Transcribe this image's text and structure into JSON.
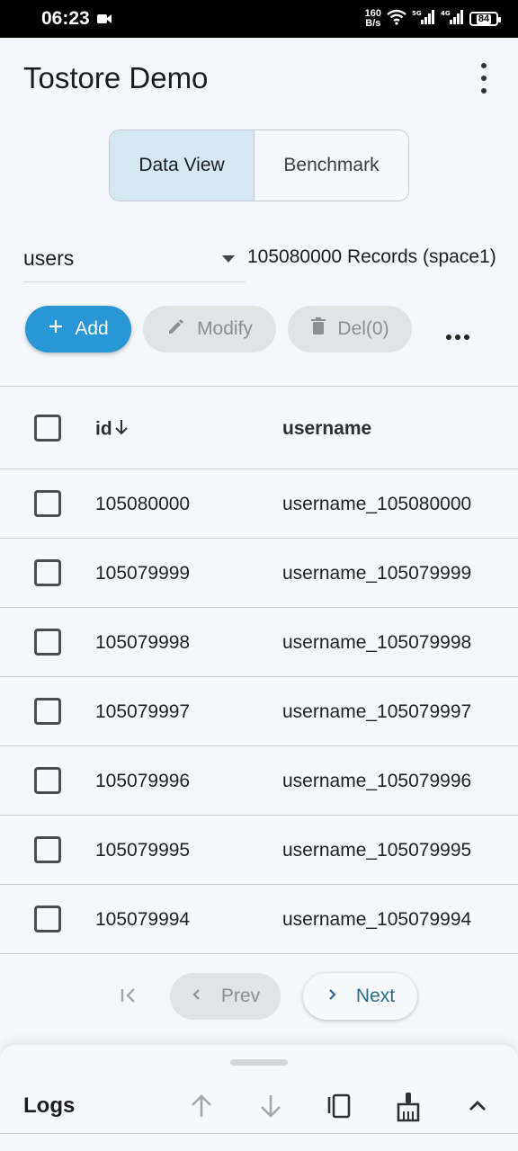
{
  "status_bar": {
    "time": "06:23",
    "net_speed_value": "160",
    "net_speed_unit": "B/s",
    "battery": "84"
  },
  "app": {
    "title": "Tostore Demo"
  },
  "tabs": [
    {
      "label": "Data View",
      "active": true
    },
    {
      "label": "Benchmark",
      "active": false
    }
  ],
  "table_selector": {
    "value": "users",
    "record_count": "105080000 Records (space1)"
  },
  "actions": {
    "add": "Add",
    "modify": "Modify",
    "delete": "Del(0)"
  },
  "table": {
    "columns": [
      "id",
      "username"
    ],
    "rows": [
      {
        "id": "105080000",
        "username": "username_105080000"
      },
      {
        "id": "105079999",
        "username": "username_105079999"
      },
      {
        "id": "105079998",
        "username": "username_105079998"
      },
      {
        "id": "105079997",
        "username": "username_105079997"
      },
      {
        "id": "105079996",
        "username": "username_105079996"
      },
      {
        "id": "105079995",
        "username": "username_105079995"
      },
      {
        "id": "105079994",
        "username": "username_105079994"
      }
    ]
  },
  "pagination": {
    "prev": "Prev",
    "next": "Next"
  },
  "logs": {
    "title": "Logs"
  },
  "colors": {
    "accent": "#2997d6",
    "selected_tab": "#d5e8f2",
    "next_text": "#2a6a8c"
  }
}
